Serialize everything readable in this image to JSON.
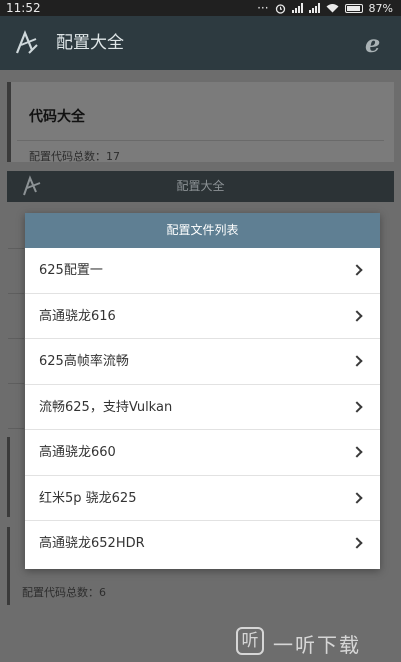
{
  "status_bar": {
    "time": "11:52",
    "more_glyph": "···",
    "battery": "87%",
    "icons": [
      "alarm-icon",
      "signal-icon",
      "wifi-icon",
      "battery-icon"
    ]
  },
  "app_bar": {
    "title": "配置大全",
    "logo_icon": "app-logo-icon",
    "action_icon_glyph": "e"
  },
  "background": {
    "card_title": "代码大全",
    "card_count": "配置代码总数：17",
    "bar_title": "配置大全",
    "card_count_2": "配置代码总数：6"
  },
  "dialog": {
    "title": "配置文件列表",
    "items": [
      {
        "label": "625配置一"
      },
      {
        "label": "高通骁龙616"
      },
      {
        "label": "625高帧率流畅"
      },
      {
        "label": "流畅625，支持Vulkan"
      },
      {
        "label": "高通骁龙660"
      },
      {
        "label": "红米5p 骁龙625"
      },
      {
        "label": "高通骁龙652HDR"
      }
    ]
  },
  "watermark": {
    "mark": "听",
    "text": "一听下载"
  },
  "colors": {
    "app_bar": "#2d3a40",
    "dialog_header": "#5f7f93",
    "scrim": "#6d6d6d"
  }
}
